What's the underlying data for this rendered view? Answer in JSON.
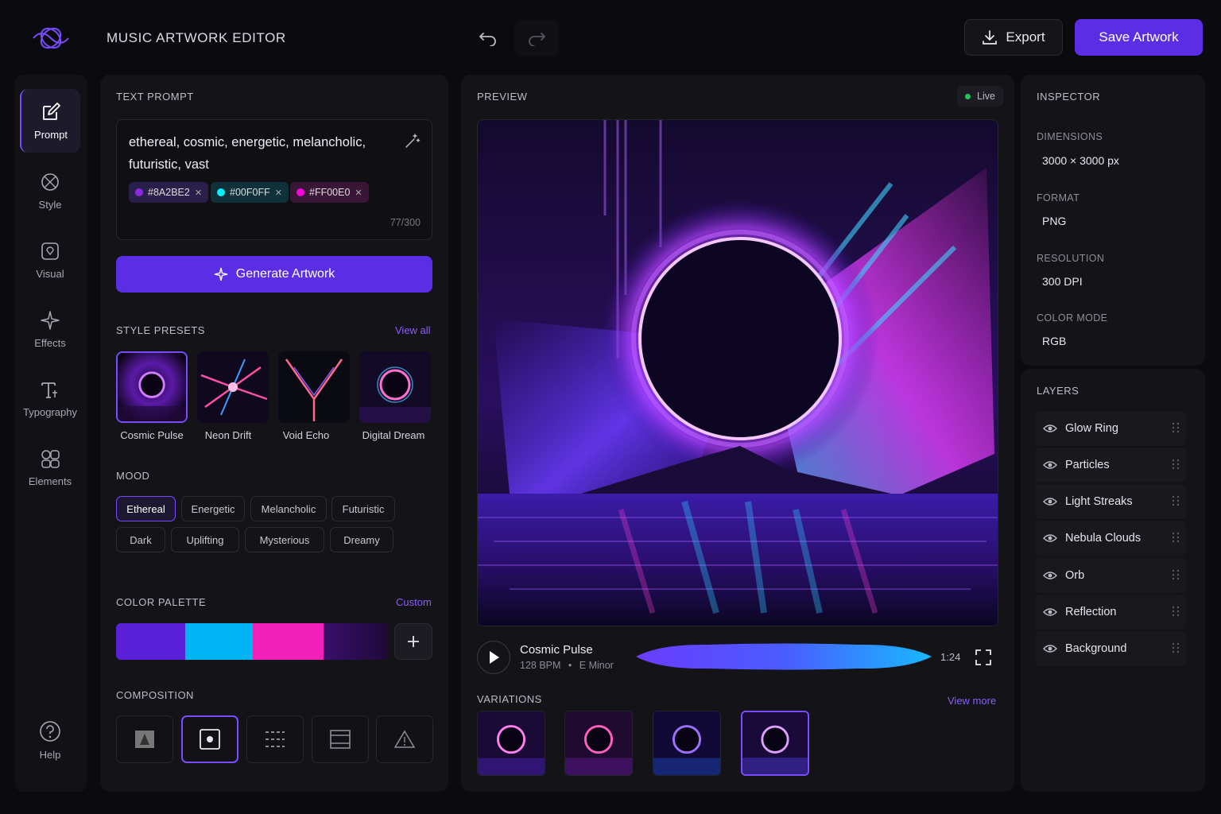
{
  "header": {
    "app_title": "MUSIC ARTWORK EDITOR",
    "export_label": "Export",
    "save_label": "Save Artwork"
  },
  "rail": {
    "items": [
      {
        "label": "Prompt",
        "icon": "edit-icon"
      },
      {
        "label": "Style",
        "icon": "style-icon"
      },
      {
        "label": "Visual",
        "icon": "visual-icon"
      },
      {
        "label": "Effects",
        "icon": "sparkle-icon"
      },
      {
        "label": "Typography",
        "icon": "typography-icon"
      },
      {
        "label": "Elements",
        "icon": "elements-icon"
      }
    ],
    "help_label": "Help"
  },
  "prompt": {
    "section_title": "TEXT PROMPT",
    "text": "ethereal, cosmic, energetic, melancholic, futuristic, vast",
    "chips": [
      {
        "label": "#8A2BE2",
        "color": "#8A2BE2"
      },
      {
        "label": "#00F0FF",
        "color": "#00F0FF"
      },
      {
        "label": "#FF00E0",
        "color": "#FF00E0"
      }
    ],
    "count": "77/300",
    "generate_label": "Generate Artwork"
  },
  "presets": {
    "section_title": "STYLE PRESETS",
    "view_all": "View all",
    "items": [
      "Cosmic Pulse",
      "Neon Drift",
      "Void Echo",
      "Digital Dream"
    ]
  },
  "mood": {
    "section_title": "MOOD",
    "items": [
      "Ethereal",
      "Energetic",
      "Melancholic",
      "Futuristic",
      "Dark",
      "Uplifting",
      "Mysterious",
      "Dreamy"
    ],
    "selected": "Ethereal"
  },
  "palette": {
    "section_title": "COLOR PALETTE",
    "custom": "Custom",
    "colors": [
      "#5B21D8",
      "#00B4F5",
      "#F020B8",
      "#3A0F6E"
    ]
  },
  "composition": {
    "section_title": "COMPOSITION"
  },
  "preview": {
    "section_title": "PREVIEW",
    "live": "Live",
    "track_name": "Cosmic Pulse",
    "bpm": "128 BPM",
    "key": "E Minor",
    "time": "1:24",
    "variations_title": "VARIATIONS",
    "view_more": "View more"
  },
  "inspector": {
    "section_title": "INSPECTOR",
    "dimensions_label": "DIMENSIONS",
    "dimensions": "3000 × 3000 px",
    "format_label": "FORMAT",
    "format": "PNG",
    "resolution_label": "RESOLUTION",
    "resolution": "300 DPI",
    "color_mode_label": "COLOR MODE",
    "color_mode": "RGB"
  },
  "layers": {
    "section_title": "LAYERS",
    "items": [
      "Glow Ring",
      "Particles",
      "Light Streaks",
      "Nebula Clouds",
      "Orb",
      "Reflection",
      "Background"
    ]
  }
}
